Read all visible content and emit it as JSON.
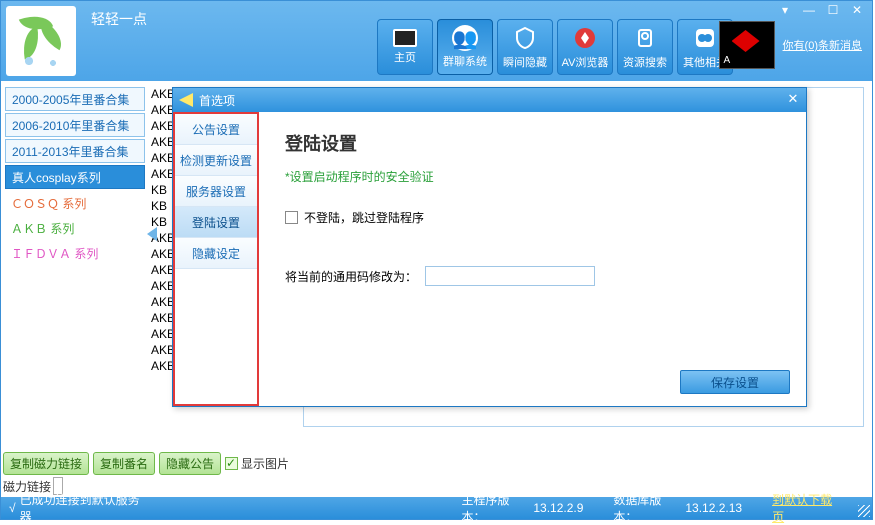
{
  "app": {
    "title": "轻轻一点"
  },
  "window_controls": {
    "tool": "▾",
    "min": "—",
    "max": "☐",
    "close": "✕"
  },
  "toolbar": [
    {
      "label": "主页",
      "icon": "monitor"
    },
    {
      "label": "群聊系统",
      "icon": "group"
    },
    {
      "label": "瞬间隐藏",
      "icon": "shield"
    },
    {
      "label": "AV浏览器",
      "icon": "av"
    },
    {
      "label": "资源搜索",
      "icon": "search"
    },
    {
      "label": "其他相关",
      "icon": "other"
    }
  ],
  "header_link": "你有(0)条新消息",
  "sidebar": {
    "items": [
      "2000-2005年里番合集",
      "2006-2010年里番合集",
      "2011-2013年里番合集",
      "真人cosplay系列"
    ],
    "sub": [
      "ＣＯＳＱ 系列",
      "ＡＫＢ 系列",
      "ＩＦＤＶＡ 系列"
    ]
  },
  "list": [
    "AKB",
    "AKB",
    "AKB",
    "AKB",
    "AKB",
    "AKB",
    "KB",
    "KB",
    "KB",
    "AKB",
    "AKB",
    "AKB",
    "AKB",
    "AKB",
    "AKB",
    "AKB",
    "AKB",
    "AKB"
  ],
  "bottom": {
    "buttons": [
      "复制磁力链接",
      "复制番名",
      "隐藏公告"
    ],
    "show_image": "显示图片",
    "magnet_label": "磁力链接"
  },
  "status": {
    "connected": "已成功连接到默认服务器",
    "main_ver_label": "主程序版本：",
    "main_ver": "13.12.2.9",
    "db_ver_label": "数据库版本：",
    "db_ver": "13.12.2.13",
    "dl_link": "到默认下载页"
  },
  "dialog": {
    "title": "首选项",
    "nav": [
      "公告设置",
      "检测更新设置",
      "服务器设置",
      "登陆设置",
      "隐藏设定"
    ],
    "heading": "登陆设置",
    "note": "设置启动程序时的安全验证",
    "skip_login": "不登陆，跳过登陆程序",
    "field_label": "将当前的通用码修改为：",
    "save": "保存设置"
  }
}
